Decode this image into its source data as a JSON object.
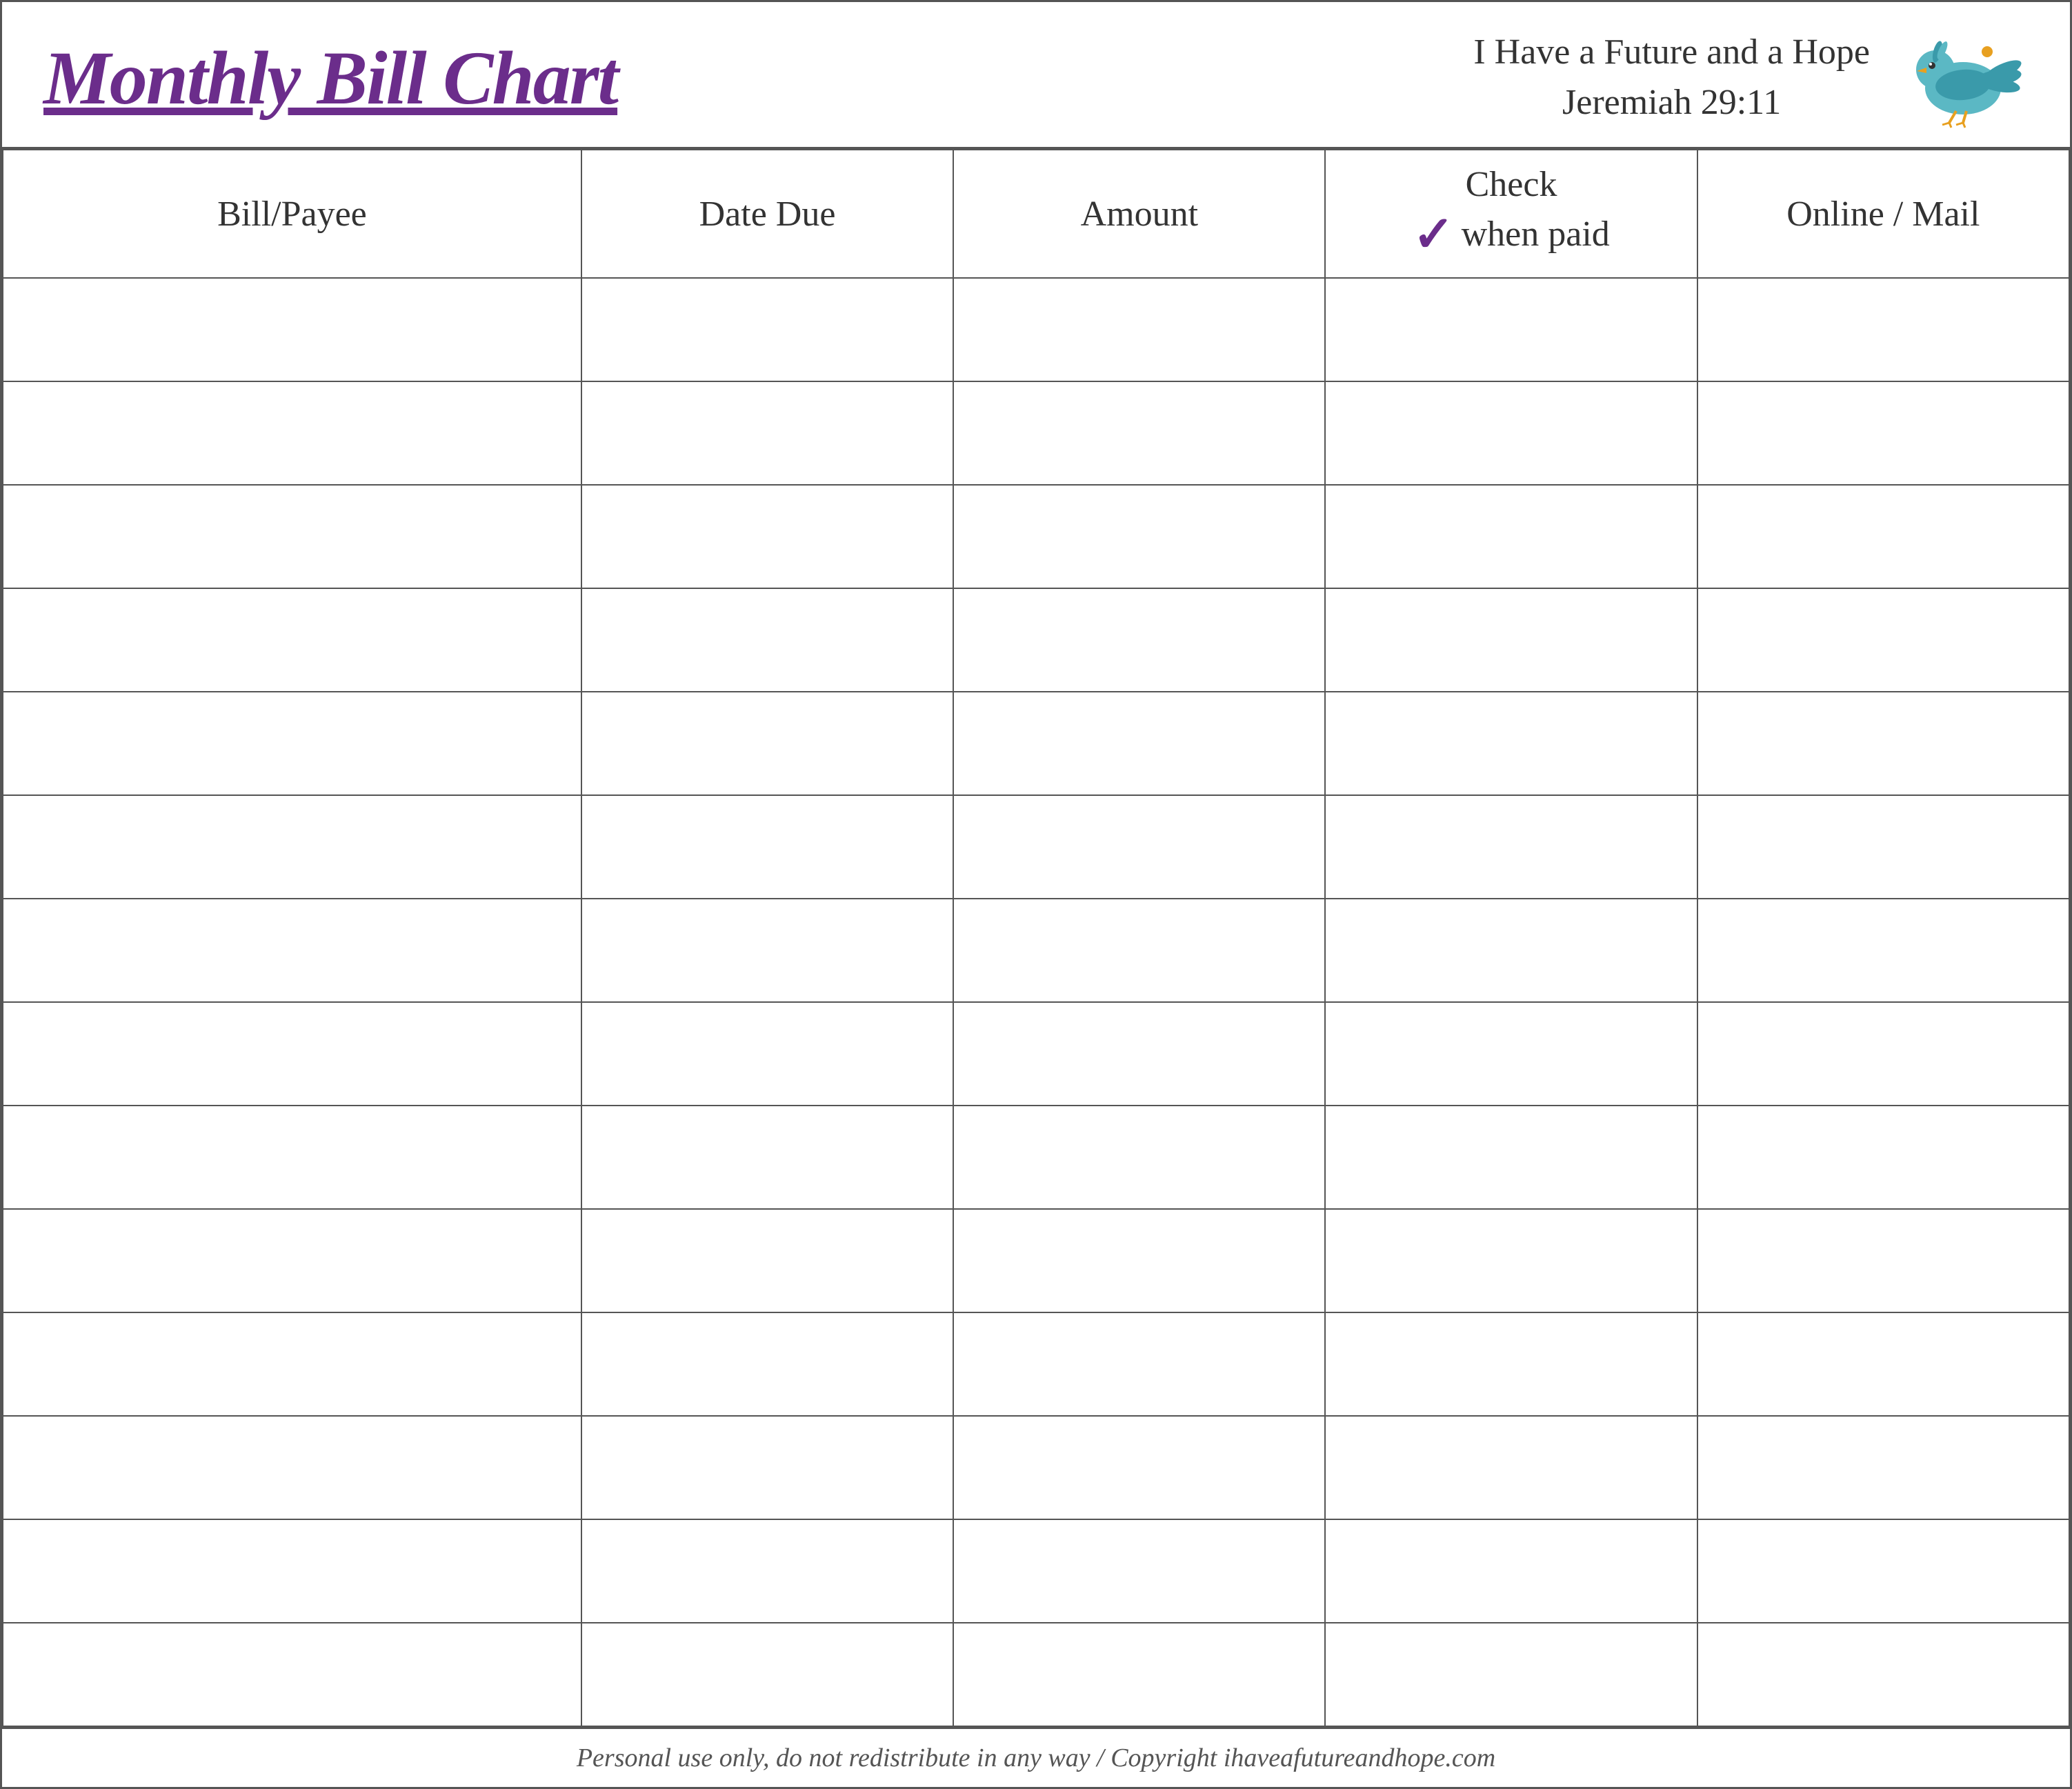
{
  "header": {
    "title": "Monthly Bill Chart",
    "verse_line1": "I Have a Future and a Hope",
    "verse_line2": "Jeremiah 29:11"
  },
  "table": {
    "columns": [
      {
        "id": "bill",
        "label": "Bill/Payee"
      },
      {
        "id": "date",
        "label": "Date Due"
      },
      {
        "id": "amount",
        "label": "Amount"
      },
      {
        "id": "check",
        "label_top": "Check",
        "label_bottom": "when paid"
      },
      {
        "id": "online",
        "label": "Online / Mail"
      }
    ],
    "row_count": 14
  },
  "footer": {
    "text": "Personal use only, do not redistribute in any way / Copyright ihaveafutureandhope.com"
  },
  "colors": {
    "purple": "#6b2d8b",
    "border": "#555",
    "text": "#333"
  }
}
